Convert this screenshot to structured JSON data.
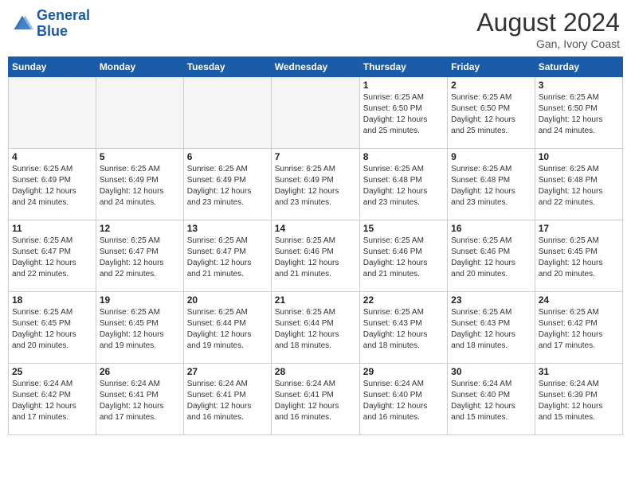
{
  "header": {
    "logo_line1": "General",
    "logo_line2": "Blue",
    "month_title": "August 2024",
    "location": "Gan, Ivory Coast"
  },
  "weekdays": [
    "Sunday",
    "Monday",
    "Tuesday",
    "Wednesday",
    "Thursday",
    "Friday",
    "Saturday"
  ],
  "weeks": [
    [
      {
        "day": "",
        "info": ""
      },
      {
        "day": "",
        "info": ""
      },
      {
        "day": "",
        "info": ""
      },
      {
        "day": "",
        "info": ""
      },
      {
        "day": "1",
        "info": "Sunrise: 6:25 AM\nSunset: 6:50 PM\nDaylight: 12 hours\nand 25 minutes."
      },
      {
        "day": "2",
        "info": "Sunrise: 6:25 AM\nSunset: 6:50 PM\nDaylight: 12 hours\nand 25 minutes."
      },
      {
        "day": "3",
        "info": "Sunrise: 6:25 AM\nSunset: 6:50 PM\nDaylight: 12 hours\nand 24 minutes."
      }
    ],
    [
      {
        "day": "4",
        "info": "Sunrise: 6:25 AM\nSunset: 6:49 PM\nDaylight: 12 hours\nand 24 minutes."
      },
      {
        "day": "5",
        "info": "Sunrise: 6:25 AM\nSunset: 6:49 PM\nDaylight: 12 hours\nand 24 minutes."
      },
      {
        "day": "6",
        "info": "Sunrise: 6:25 AM\nSunset: 6:49 PM\nDaylight: 12 hours\nand 23 minutes."
      },
      {
        "day": "7",
        "info": "Sunrise: 6:25 AM\nSunset: 6:49 PM\nDaylight: 12 hours\nand 23 minutes."
      },
      {
        "day": "8",
        "info": "Sunrise: 6:25 AM\nSunset: 6:48 PM\nDaylight: 12 hours\nand 23 minutes."
      },
      {
        "day": "9",
        "info": "Sunrise: 6:25 AM\nSunset: 6:48 PM\nDaylight: 12 hours\nand 23 minutes."
      },
      {
        "day": "10",
        "info": "Sunrise: 6:25 AM\nSunset: 6:48 PM\nDaylight: 12 hours\nand 22 minutes."
      }
    ],
    [
      {
        "day": "11",
        "info": "Sunrise: 6:25 AM\nSunset: 6:47 PM\nDaylight: 12 hours\nand 22 minutes."
      },
      {
        "day": "12",
        "info": "Sunrise: 6:25 AM\nSunset: 6:47 PM\nDaylight: 12 hours\nand 22 minutes."
      },
      {
        "day": "13",
        "info": "Sunrise: 6:25 AM\nSunset: 6:47 PM\nDaylight: 12 hours\nand 21 minutes."
      },
      {
        "day": "14",
        "info": "Sunrise: 6:25 AM\nSunset: 6:46 PM\nDaylight: 12 hours\nand 21 minutes."
      },
      {
        "day": "15",
        "info": "Sunrise: 6:25 AM\nSunset: 6:46 PM\nDaylight: 12 hours\nand 21 minutes."
      },
      {
        "day": "16",
        "info": "Sunrise: 6:25 AM\nSunset: 6:46 PM\nDaylight: 12 hours\nand 20 minutes."
      },
      {
        "day": "17",
        "info": "Sunrise: 6:25 AM\nSunset: 6:45 PM\nDaylight: 12 hours\nand 20 minutes."
      }
    ],
    [
      {
        "day": "18",
        "info": "Sunrise: 6:25 AM\nSunset: 6:45 PM\nDaylight: 12 hours\nand 20 minutes."
      },
      {
        "day": "19",
        "info": "Sunrise: 6:25 AM\nSunset: 6:45 PM\nDaylight: 12 hours\nand 19 minutes."
      },
      {
        "day": "20",
        "info": "Sunrise: 6:25 AM\nSunset: 6:44 PM\nDaylight: 12 hours\nand 19 minutes."
      },
      {
        "day": "21",
        "info": "Sunrise: 6:25 AM\nSunset: 6:44 PM\nDaylight: 12 hours\nand 18 minutes."
      },
      {
        "day": "22",
        "info": "Sunrise: 6:25 AM\nSunset: 6:43 PM\nDaylight: 12 hours\nand 18 minutes."
      },
      {
        "day": "23",
        "info": "Sunrise: 6:25 AM\nSunset: 6:43 PM\nDaylight: 12 hours\nand 18 minutes."
      },
      {
        "day": "24",
        "info": "Sunrise: 6:25 AM\nSunset: 6:42 PM\nDaylight: 12 hours\nand 17 minutes."
      }
    ],
    [
      {
        "day": "25",
        "info": "Sunrise: 6:24 AM\nSunset: 6:42 PM\nDaylight: 12 hours\nand 17 minutes."
      },
      {
        "day": "26",
        "info": "Sunrise: 6:24 AM\nSunset: 6:41 PM\nDaylight: 12 hours\nand 17 minutes."
      },
      {
        "day": "27",
        "info": "Sunrise: 6:24 AM\nSunset: 6:41 PM\nDaylight: 12 hours\nand 16 minutes."
      },
      {
        "day": "28",
        "info": "Sunrise: 6:24 AM\nSunset: 6:41 PM\nDaylight: 12 hours\nand 16 minutes."
      },
      {
        "day": "29",
        "info": "Sunrise: 6:24 AM\nSunset: 6:40 PM\nDaylight: 12 hours\nand 16 minutes."
      },
      {
        "day": "30",
        "info": "Sunrise: 6:24 AM\nSunset: 6:40 PM\nDaylight: 12 hours\nand 15 minutes."
      },
      {
        "day": "31",
        "info": "Sunrise: 6:24 AM\nSunset: 6:39 PM\nDaylight: 12 hours\nand 15 minutes."
      }
    ]
  ]
}
